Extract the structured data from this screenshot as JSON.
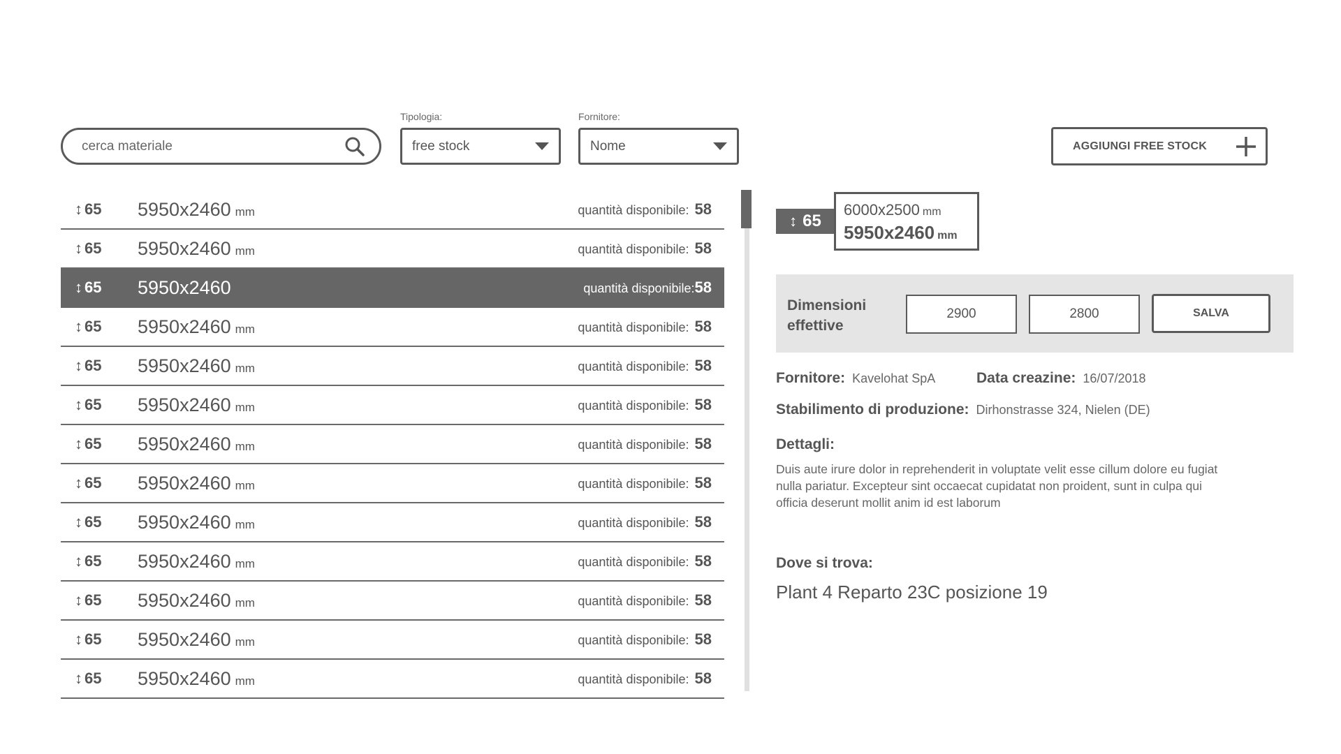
{
  "search": {
    "placeholder": "cerca materiale"
  },
  "filters": {
    "tipologia": {
      "label": "Tipologia:",
      "value": "free stock"
    },
    "fornitore": {
      "label": "Fornitore:",
      "value": "Nome"
    }
  },
  "add_button": {
    "label": "AGGIUNGI FREE STOCK"
  },
  "list": {
    "items": [
      {
        "thickness": "65",
        "dimensions": "5950x2460",
        "unit": "mm",
        "qty_label": "quantità disponibile:",
        "qty": "58"
      },
      {
        "thickness": "65",
        "dimensions": "5950x2460",
        "unit": "mm",
        "qty_label": "quantità disponibile:",
        "qty": "58"
      },
      {
        "thickness": "65",
        "dimensions": "5950x2460",
        "unit": "",
        "qty_label": "quantità disponibile:",
        "qty": "58"
      },
      {
        "thickness": "65",
        "dimensions": "5950x2460",
        "unit": "mm",
        "qty_label": "quantità disponibile:",
        "qty": "58"
      },
      {
        "thickness": "65",
        "dimensions": "5950x2460",
        "unit": "mm",
        "qty_label": "quantità disponibile:",
        "qty": "58"
      },
      {
        "thickness": "65",
        "dimensions": "5950x2460",
        "unit": "mm",
        "qty_label": "quantità disponibile:",
        "qty": "58"
      },
      {
        "thickness": "65",
        "dimensions": "5950x2460",
        "unit": "mm",
        "qty_label": "quantità disponibile:",
        "qty": "58"
      },
      {
        "thickness": "65",
        "dimensions": "5950x2460",
        "unit": "mm",
        "qty_label": "quantità disponibile:",
        "qty": "58"
      },
      {
        "thickness": "65",
        "dimensions": "5950x2460",
        "unit": "mm",
        "qty_label": "quantità disponibile:",
        "qty": "58"
      },
      {
        "thickness": "65",
        "dimensions": "5950x2460",
        "unit": "mm",
        "qty_label": "quantità disponibile:",
        "qty": "58"
      },
      {
        "thickness": "65",
        "dimensions": "5950x2460",
        "unit": "mm",
        "qty_label": "quantità disponibile:",
        "qty": "58"
      },
      {
        "thickness": "65",
        "dimensions": "5950x2460",
        "unit": "mm",
        "qty_label": "quantità disponibile:",
        "qty": "58"
      },
      {
        "thickness": "65",
        "dimensions": "5950x2460",
        "unit": "mm",
        "qty_label": "quantità disponibile:",
        "qty": "58"
      }
    ]
  },
  "detail": {
    "thickness": "65",
    "size_original": "6000x2500",
    "size_original_unit": "mm",
    "size_current": "5950x2460",
    "size_current_unit": "mm",
    "dimensioni": {
      "label": "Dimensioni effettive",
      "width": "2900",
      "height": "2800",
      "save_label": "SALVA"
    },
    "fornitore_label": "Fornitore:",
    "fornitore_value": "Kavelohat SpA",
    "data_label": "Data creazine:",
    "data_value": "16/07/2018",
    "stabilimento_label": "Stabilimento di produzione:",
    "stabilimento_value": "Dirhonstrasse 324, Nielen (DE)",
    "dettagli_label": "Dettagli:",
    "dettagli_text": "Duis aute irure dolor in reprehenderit in voluptate velit esse cillum dolore eu fugiat nulla pariatur. Excepteur sint occaecat cupidatat non proident, sunt in culpa qui officia deserunt mollit anim id est laborum",
    "dove_label": "Dove si trova:",
    "dove_value": "Plant 4 Reparto 23C posizione 19"
  },
  "selected_row_index": 2,
  "colors": {
    "accent": "#666666",
    "border": "#5a5a5a",
    "panel_bg": "#e5e5e5"
  }
}
